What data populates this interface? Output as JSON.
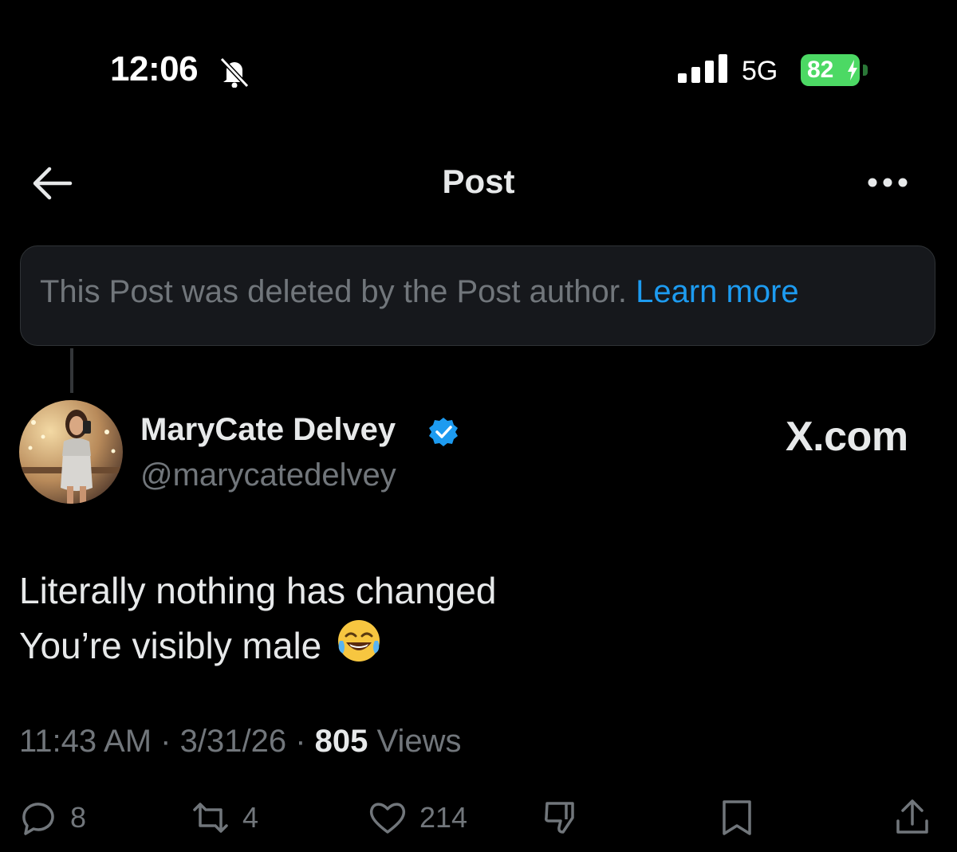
{
  "status_bar": {
    "time": "12:06",
    "network": "5G",
    "battery": "82"
  },
  "header": {
    "title": "Post"
  },
  "notice": {
    "text": "This Post was deleted by the Post author.",
    "link": "Learn more"
  },
  "author": {
    "name": "MaryCate Delvey",
    "handle": "@marycatedelvey"
  },
  "watermark": "X.com",
  "post": {
    "line1": "Literally nothing has changed",
    "line2": "You’re visibly male"
  },
  "meta": {
    "time": "11:43 AM",
    "date": "3/31/26",
    "views_count": "805",
    "views_label": "Views",
    "separator": "·"
  },
  "actions": {
    "replies": "8",
    "reposts": "4",
    "likes": "214"
  },
  "colors": {
    "background": "#000000",
    "text": "#e7e9ea",
    "muted": "#71767b",
    "link": "#1d9bf0",
    "battery": "#4cd964"
  }
}
